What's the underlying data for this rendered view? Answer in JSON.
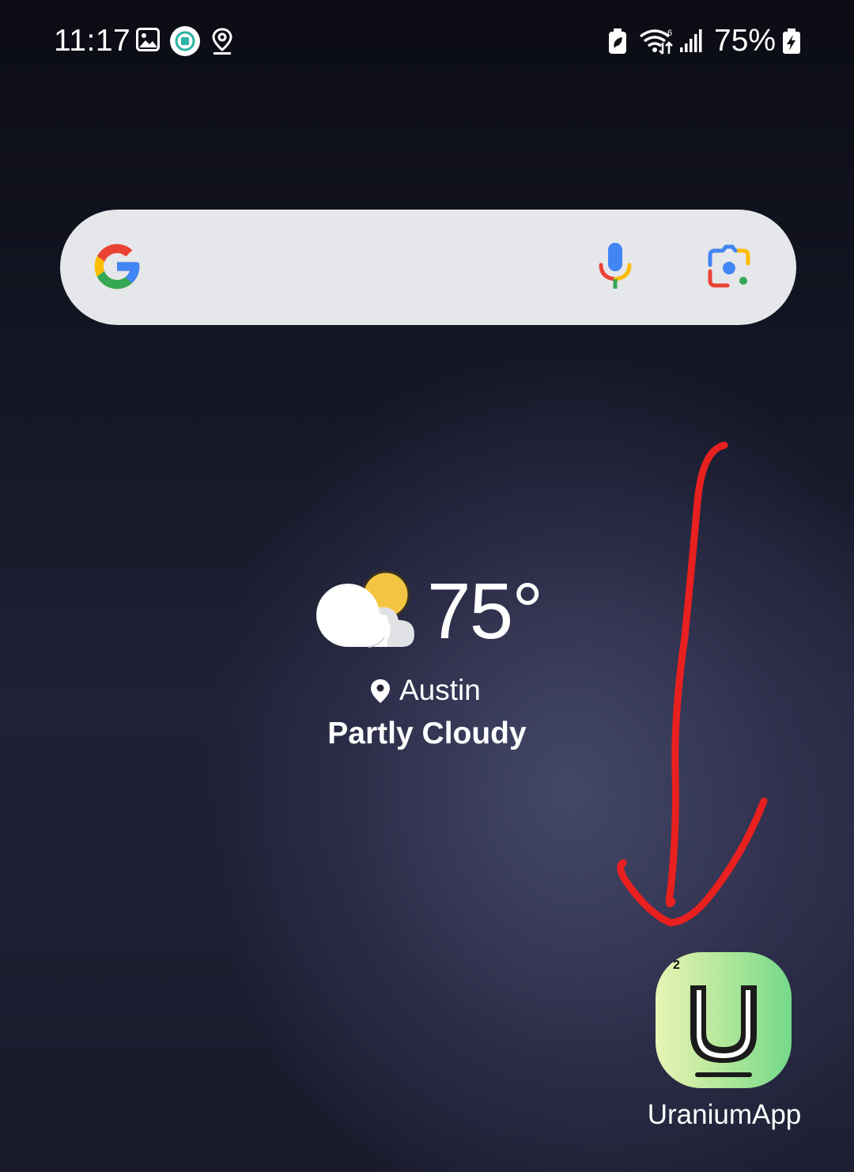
{
  "status_bar": {
    "time": "11:17",
    "battery_percent": "75%",
    "left_icons": [
      "gallery-icon",
      "app-notification-icon",
      "location-icon"
    ],
    "right_icons": [
      "battery-saver-icon",
      "wifi-icon",
      "signal-icon",
      "battery-charging-icon"
    ]
  },
  "search_widget": {
    "icons": [
      "google-logo",
      "mic-icon",
      "google-lens-icon"
    ],
    "colors": {
      "blue": "#4285F4",
      "red": "#EA4335",
      "yellow": "#FBBC05",
      "green": "#34A853",
      "background": "#e6e7ea"
    }
  },
  "weather": {
    "temperature": "75°",
    "city": "Austin",
    "condition": "Partly Cloudy",
    "icon": "partly-cloudy-icon"
  },
  "home_apps": [
    {
      "label": "UraniumApp",
      "icon": "uranium-app-icon",
      "badge": "2"
    }
  ],
  "annotation": {
    "type": "arrow",
    "color": "#e8201f",
    "points_to": "UraniumApp"
  }
}
